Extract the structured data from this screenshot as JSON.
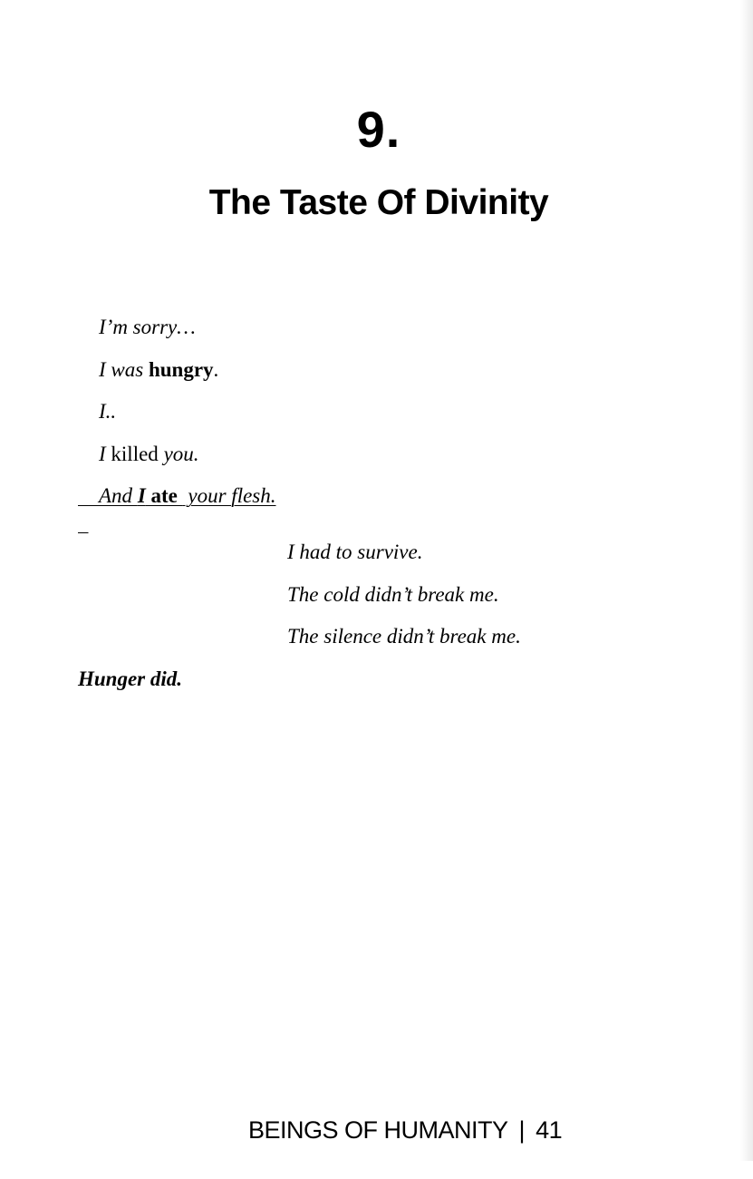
{
  "chapter": {
    "number": "9.",
    "title": "The Taste Of Divinity"
  },
  "poem": {
    "l1": {
      "a": "I’m sorry…"
    },
    "l2": {
      "a": "I was ",
      "b": "hungry",
      "c": "."
    },
    "l3": {
      "a": "I.."
    },
    "l4": {
      "a": "I",
      "b": " killed ",
      "c": "you."
    },
    "l5": {
      "a": "And ",
      "b": "I",
      "c": " ate ",
      "d": " your flesh."
    },
    "l6": {
      "a": "I had to survive."
    },
    "l7": {
      "a": "The cold didn’t break me."
    },
    "l8": {
      "a": "The silence didn’t break me."
    },
    "l9": {
      "a": "Hunger did."
    }
  },
  "footer": {
    "book_title": "BEINGS OF HUMANITY",
    "separator": "|",
    "page_number": "41"
  }
}
